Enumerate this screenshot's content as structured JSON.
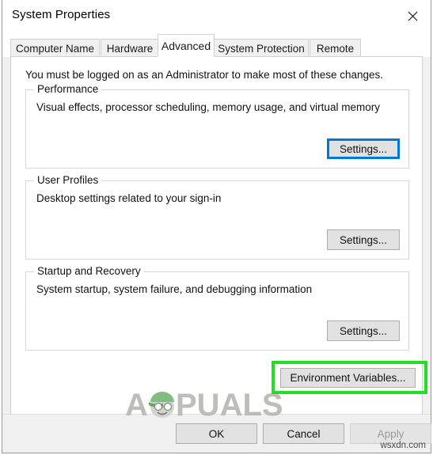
{
  "window": {
    "title": "System Properties",
    "close_icon": "close-icon"
  },
  "tabs": [
    {
      "label": "Computer Name",
      "selected": false
    },
    {
      "label": "Hardware",
      "selected": false
    },
    {
      "label": "Advanced",
      "selected": true
    },
    {
      "label": "System Protection",
      "selected": false
    },
    {
      "label": "Remote",
      "selected": false
    }
  ],
  "panel": {
    "admin_note": "You must be logged on as an Administrator to make most of these changes.",
    "groups": [
      {
        "title": "Performance",
        "description": "Visual effects, processor scheduling, memory usage, and virtual memory",
        "button_label": "Settings...",
        "button_focused": true
      },
      {
        "title": "User Profiles",
        "description": "Desktop settings related to your sign-in",
        "button_label": "Settings...",
        "button_focused": false
      },
      {
        "title": "Startup and Recovery",
        "description": "System startup, system failure, and debugging information",
        "button_label": "Settings...",
        "button_focused": false
      }
    ],
    "environment_variables_button": "Environment Variables..."
  },
  "footer": {
    "ok_label": "OK",
    "cancel_label": "Cancel",
    "apply_label": "Apply",
    "apply_disabled": true
  },
  "annotations": {
    "highlight_color": "#25dd25",
    "focus_color": "#0078d7",
    "highlight_target": "Environment Variables..."
  },
  "watermarks": {
    "brand": "APPUALS",
    "site": "wsxdn.com"
  }
}
